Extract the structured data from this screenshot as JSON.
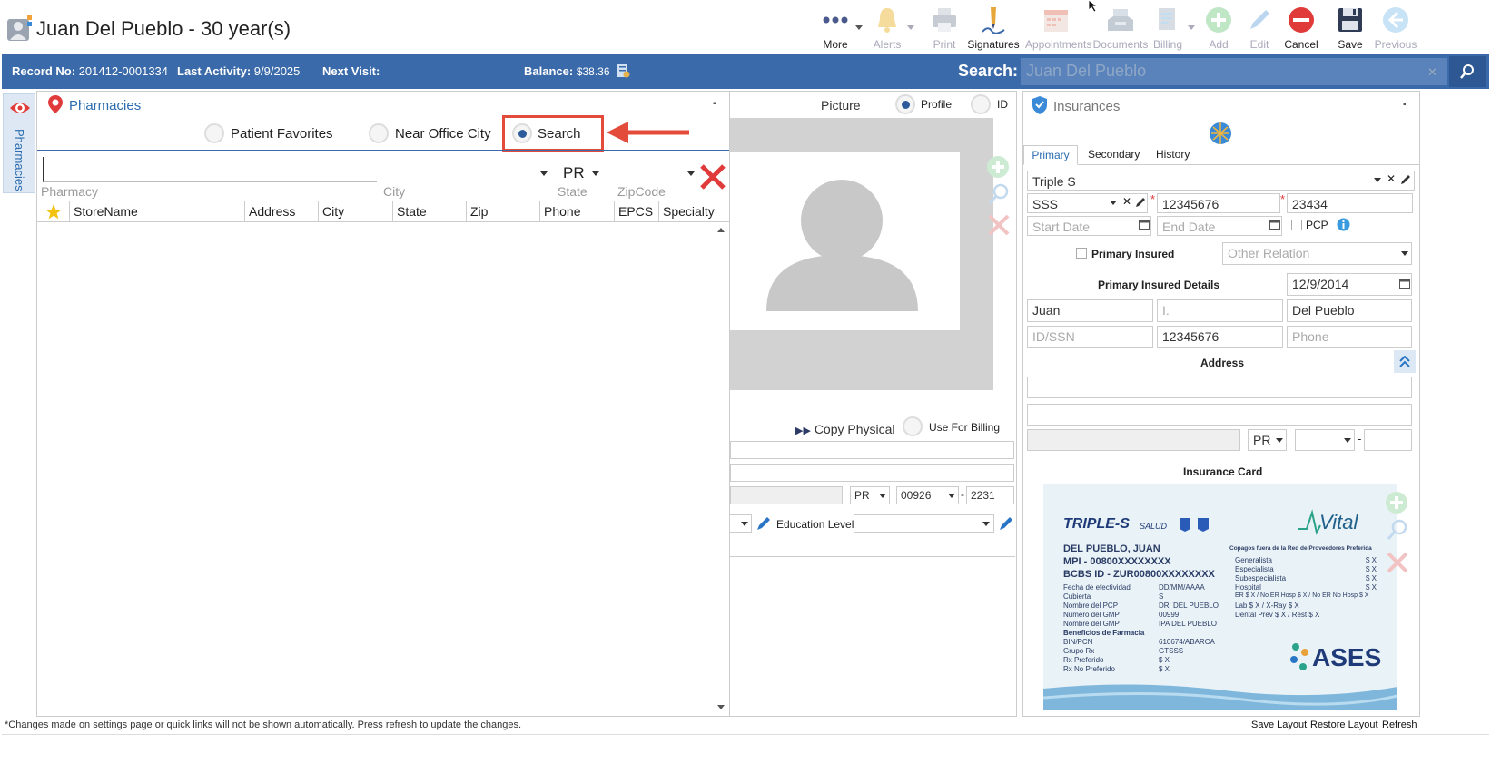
{
  "window": {
    "title": "Juan Del Pueblo - 30 year(s)"
  },
  "toolbar": {
    "items": [
      {
        "label": "More",
        "icon": "more-dots-icon",
        "enabled": true,
        "dropdown": true
      },
      {
        "label": "Alerts",
        "icon": "bell-icon",
        "enabled": false,
        "dropdown": true
      },
      {
        "label": "Print",
        "icon": "printer-icon",
        "enabled": false
      },
      {
        "label": "Signatures",
        "icon": "pen-signature-icon",
        "enabled": true
      },
      {
        "label": "Appointments",
        "icon": "calendar-icon",
        "enabled": false
      },
      {
        "label": "Documents",
        "icon": "tray-icon",
        "enabled": false
      },
      {
        "label": "Billing",
        "icon": "billing-icon",
        "enabled": false,
        "dropdown": true
      },
      {
        "label": "Add",
        "icon": "add-icon",
        "enabled": false
      },
      {
        "label": "Edit",
        "icon": "pencil-icon",
        "enabled": false
      },
      {
        "label": "Cancel",
        "icon": "cancel-icon",
        "enabled": true
      },
      {
        "label": "Save",
        "icon": "save-icon",
        "enabled": true
      },
      {
        "label": "Previous",
        "icon": "arrow-left-icon",
        "enabled": false
      }
    ]
  },
  "infobar": {
    "record_label": "Record No:",
    "record_value": "201412-0001334",
    "activity_label": "Last Activity:",
    "activity_value": "9/9/2025",
    "next_visit_label": "Next Visit:",
    "next_visit_value": "",
    "balance_label": "Balance:",
    "balance_value": "$38.36",
    "search_label": "Search:",
    "search_value": "Juan Del Pueblo"
  },
  "side_tab": {
    "label": "Pharmacies"
  },
  "pharmacies": {
    "title": "Pharmacies",
    "radio_options": [
      {
        "label": "Patient Favorites",
        "selected": false
      },
      {
        "label": "Near Office City",
        "selected": false
      },
      {
        "label": "Search",
        "selected": true
      }
    ],
    "filters": {
      "pharmacy_label": "Pharmacy",
      "pharmacy_value": "",
      "city_label": "City",
      "city_value": "",
      "state_label": "State",
      "state_value": "PR",
      "zip_label": "ZipCode",
      "zip_value": ""
    },
    "columns": [
      "StoreName",
      "Address",
      "City",
      "State",
      "Zip",
      "Phone",
      "EPCS",
      "Specialty"
    ],
    "rows": []
  },
  "picture": {
    "title": "Picture",
    "options": [
      {
        "label": "Profile",
        "selected": true
      },
      {
        "label": "ID",
        "selected": false
      }
    ],
    "copy_physical": "Copy Physical",
    "use_for_billing": "Use For Billing",
    "address_state": "PR",
    "address_zip": "00926",
    "address_zip_ext": "2231",
    "education_label": "Education Level:",
    "education_value": ""
  },
  "insurances": {
    "title": "Insurances",
    "tabs": [
      {
        "label": "Primary",
        "active": true
      },
      {
        "label": "Secondary",
        "active": false
      },
      {
        "label": "History",
        "active": false
      }
    ],
    "plan": "Triple S",
    "sub_plan": "SSS",
    "policy_no": "12345676",
    "group_no": "23434",
    "start_date_placeholder": "Start Date",
    "end_date_placeholder": "End Date",
    "pcp_label": "PCP",
    "primary_insured_label": "Primary Insured",
    "other_relation_placeholder": "Other Relation",
    "details_label": "Primary Insured Details",
    "dob": "12/9/2014",
    "first_name": "Juan",
    "middle_placeholder": "I.",
    "last_name": "Del Pueblo",
    "idssn_placeholder": "ID/SSN",
    "member_id": "12345676",
    "phone_placeholder": "Phone",
    "address_label": "Address",
    "address_state": "PR",
    "card_label": "Insurance Card",
    "card": {
      "brand": "TRIPLE-S",
      "brand_sub": "SALUD",
      "vital": "Vital",
      "name": "DEL PUEBLO, JUAN",
      "mpi": "MPI - 00800XXXXXXXX",
      "bcbs": "BCBS ID - ZUR00800XXXXXXXX",
      "left_labels": [
        "Fecha de efectividad",
        "Cubierta",
        "Nombre del PCP",
        "Numero del GMP",
        "Nombre del GMP",
        "Beneficios de Farmacia",
        "BIN/PCN",
        "Grupo Rx",
        "Rx Preferido",
        "Rx No Preferido"
      ],
      "left_values": [
        "DD/MM/AAAA",
        "S",
        "DR. DEL PUEBLO",
        "00999",
        "IPA DEL PUEBLO",
        "",
        "610674/ABARCA",
        "GTSSS",
        "$ X",
        "$ X"
      ],
      "right_title": "Copagos fuera de la Red de Proveedores Preferida",
      "right_labels": [
        "Generalista",
        "Especialista",
        "Subespecialista",
        "Hospital",
        "ER $ X / No ER Hosp $ X / No ER No Hosp $ X",
        "Lab $ X / X-Ray $ X",
        "Dental Prev $ X / Rest $ X"
      ],
      "right_values": [
        "$ X",
        "$ X",
        "$ X",
        "$ X",
        "",
        "",
        ""
      ],
      "ases": "ASES"
    }
  },
  "footer": {
    "note": "*Changes made on settings page or quick links will not be shown automatically. Press refresh to update the changes.",
    "links": [
      "Save Layout",
      "Restore Layout",
      "Refresh"
    ]
  },
  "colors": {
    "brand_blue": "#3a6aa9",
    "accent_red": "#e34b3b",
    "link_blue": "#2b6cb0"
  }
}
